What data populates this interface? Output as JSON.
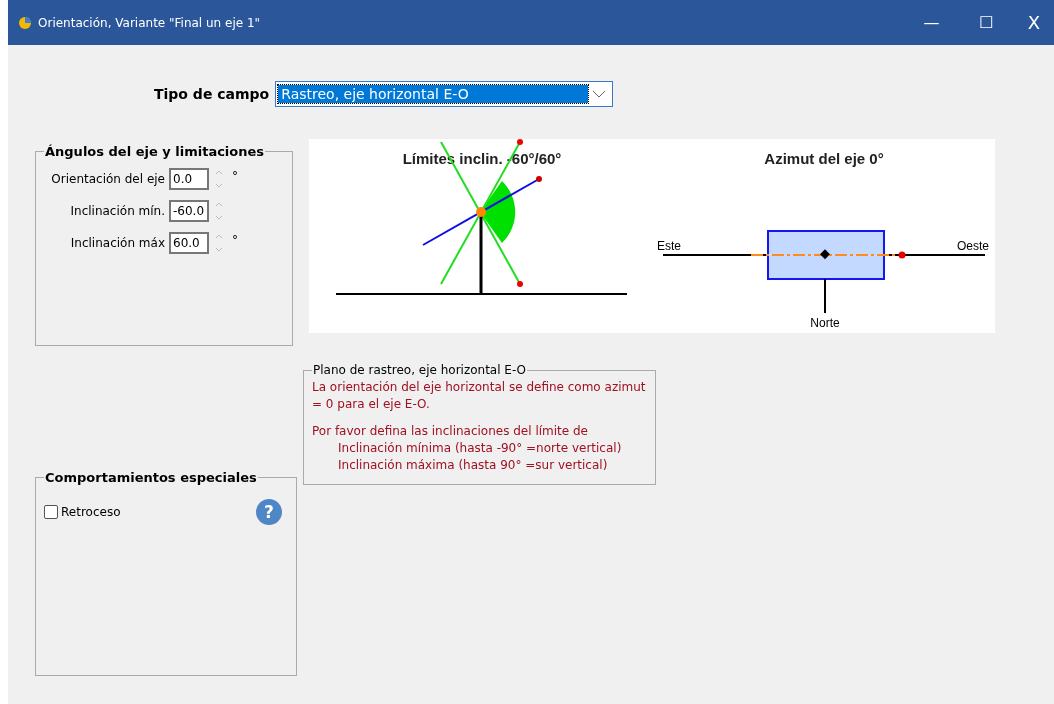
{
  "window": {
    "title": "Orientación, Variante \"Final un eje 1\"",
    "controls": [
      {
        "kind": "minimize",
        "label": "—"
      },
      {
        "kind": "maximize",
        "label": "☐"
      },
      {
        "kind": "close",
        "label": "X"
      }
    ]
  },
  "field_type": {
    "label": "Tipo de campo",
    "value": "Rastreo, eje horizontal E-O",
    "focused": true
  },
  "axis_group": {
    "title": "Ángulos del eje y limitaciones",
    "fields": [
      {
        "label": "Orientación del eje",
        "value": "0.0",
        "unit": "°"
      },
      {
        "label": "Inclinación mín.",
        "value": "-60.0"
      },
      {
        "label": "Inclinación máx",
        "value": "60.0",
        "unit": "°"
      }
    ]
  },
  "diagram": {
    "tilt_title": "Límites inclin. -60°/60°",
    "azimuth_title": "Azimut del eje 0°",
    "east": "Este",
    "west": "Oeste",
    "north": "Norte"
  },
  "info_group": {
    "title": "Plano de rastreo, eje horizontal E-O",
    "lines": [
      {
        "kind": "text",
        "text": "La orientación del eje horizontal se define como azimut = 0 para el eje E-O."
      },
      {
        "kind": "text",
        "text": "Por favor defina las inclinaciones del límite de"
      },
      {
        "kind": "indent",
        "text": "Inclinación mínima (hasta -90° =norte vertical)"
      },
      {
        "kind": "indent",
        "text": "Inclinación máxima (hasta 90° =sur vertical)"
      }
    ]
  },
  "special_group": {
    "title": "Comportamientos especiales",
    "checkbox": {
      "label": "Retroceso",
      "checked": false
    },
    "help": "?"
  }
}
